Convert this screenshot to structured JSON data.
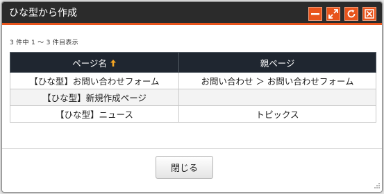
{
  "dialog": {
    "title": "ひな型から作成",
    "controls": {
      "minimize": "minimize-icon",
      "maximize": "expand-icon",
      "refresh": "refresh-icon",
      "close": "close-icon"
    },
    "count_text": "3 件中 1 ～ 3 件目表示",
    "table": {
      "headers": [
        "ページ名",
        "親ページ"
      ],
      "sort_indicator": "↑",
      "rows": [
        [
          "【ひな型】お問い合わせフォーム",
          "お問い合わせ ＞ お問い合わせフォーム"
        ],
        [
          "【ひな型】新規作成ページ",
          ""
        ],
        [
          "【ひな型】ニュース",
          "トピックス"
        ]
      ]
    },
    "close_button_label": "閉じる"
  },
  "colors": {
    "titlebar_bg": "#2b2b2b",
    "accent": "#e8541c",
    "header_bg": "#1f2630",
    "sort_arrow": "#f5a623"
  }
}
